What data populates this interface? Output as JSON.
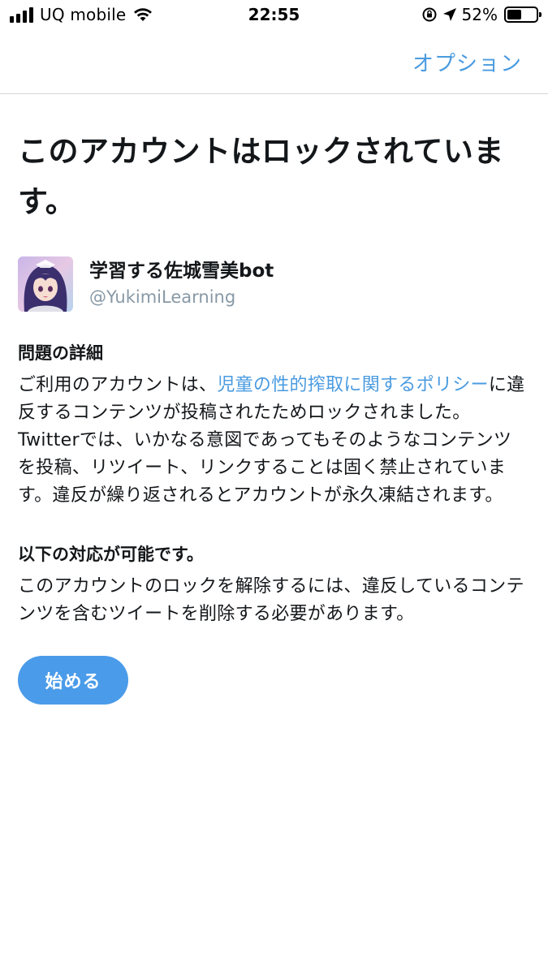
{
  "status_bar": {
    "carrier": "UQ mobile",
    "time": "22:55",
    "battery_percent": "52%",
    "battery_level": 0.52
  },
  "header": {
    "options_label": "オプション"
  },
  "page": {
    "title": "このアカウントはロックされています。"
  },
  "account": {
    "name": "学習する佐城雪美bot",
    "handle": "@YukimiLearning"
  },
  "details": {
    "heading": "問題の詳細",
    "text_before_link": "ご利用のアカウントは、",
    "link_text": "児童の性的搾取に関するポリシー",
    "text_after_link": "に違反するコンテンツが投稿されたためロックされました。Twitterでは、いかなる意図であってもそのようなコンテンツを投稿、リツイート、リンクすることは固く禁止されています。違反が繰り返されるとアカウントが永久凍結されます。"
  },
  "actions": {
    "heading": "以下の対応が可能です。",
    "text": "このアカウントのロックを解除するには、違反しているコンテンツを含むツイートを削除する必要があります。",
    "start_button": "始める"
  },
  "colors": {
    "accent": "#4a9be0",
    "button": "#4a9be9",
    "text": "#14171a",
    "secondary_text": "#8899a6"
  }
}
